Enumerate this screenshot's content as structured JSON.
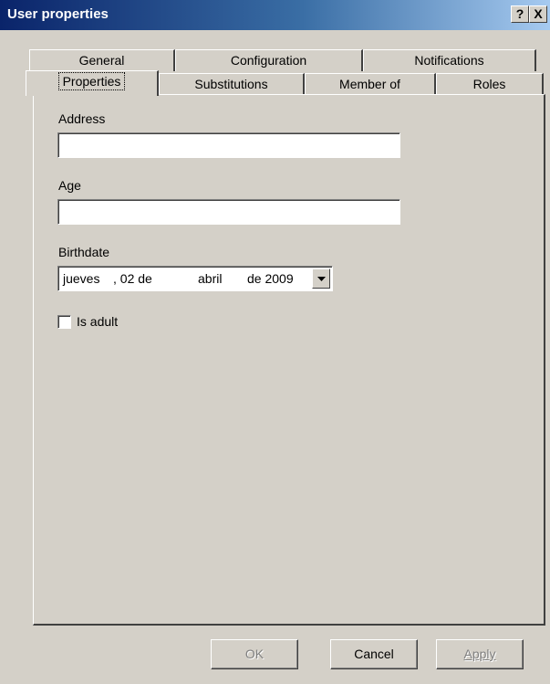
{
  "window": {
    "title": "User properties",
    "help_label": "?",
    "close_label": "X"
  },
  "tabs_back": [
    "General",
    "Configuration",
    "Notifications"
  ],
  "tabs_front": [
    "Properties",
    "Substitutions",
    "Member of",
    "Roles"
  ],
  "active_tab": "Properties",
  "form": {
    "address_label": "Address",
    "address_value": "",
    "age_label": "Age",
    "age_value": "",
    "birthdate_label": "Birthdate",
    "birthdate": {
      "weekday": "jueves",
      "day": ", 02 de",
      "month": "abril",
      "year": "de 2009"
    },
    "is_adult_label": "Is adult",
    "is_adult_checked": false
  },
  "buttons": {
    "ok": "OK",
    "cancel": "Cancel",
    "apply": "Apply"
  }
}
